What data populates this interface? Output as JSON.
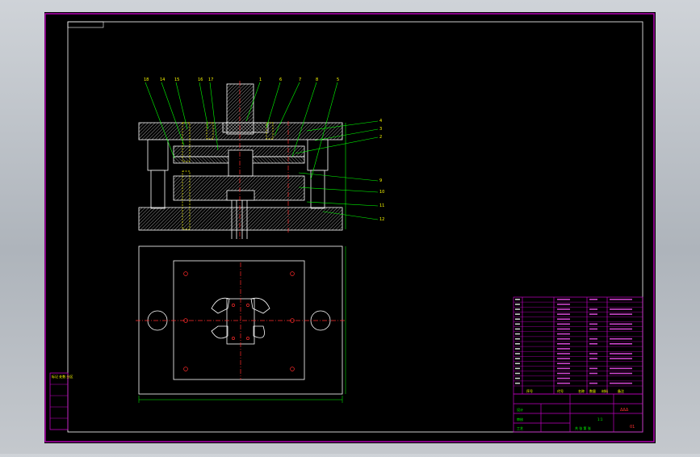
{
  "viewport": {
    "background": "#000000",
    "frame_color": "#c000c0",
    "line_color": "#ffffff",
    "leader_color": "#00ff00",
    "center_color": "#ff2a2a"
  },
  "section_view": {
    "top_callouts": [
      "18",
      "14",
      "15",
      "16",
      "17",
      "1",
      "6",
      "7",
      "8",
      "5"
    ],
    "side_callouts": [
      "4",
      "3",
      "2",
      "9",
      "10",
      "11",
      "12"
    ]
  },
  "side_label": "标记 处数 分区",
  "title_block": {
    "left_cells": [
      "设计",
      "审核",
      "工艺"
    ],
    "header_cells": [
      "序号",
      "代号",
      "名称",
      "数量",
      "材料",
      "备注"
    ],
    "drawing_number": "01",
    "scale": "1:1",
    "sheet": "共  张  第  张"
  }
}
